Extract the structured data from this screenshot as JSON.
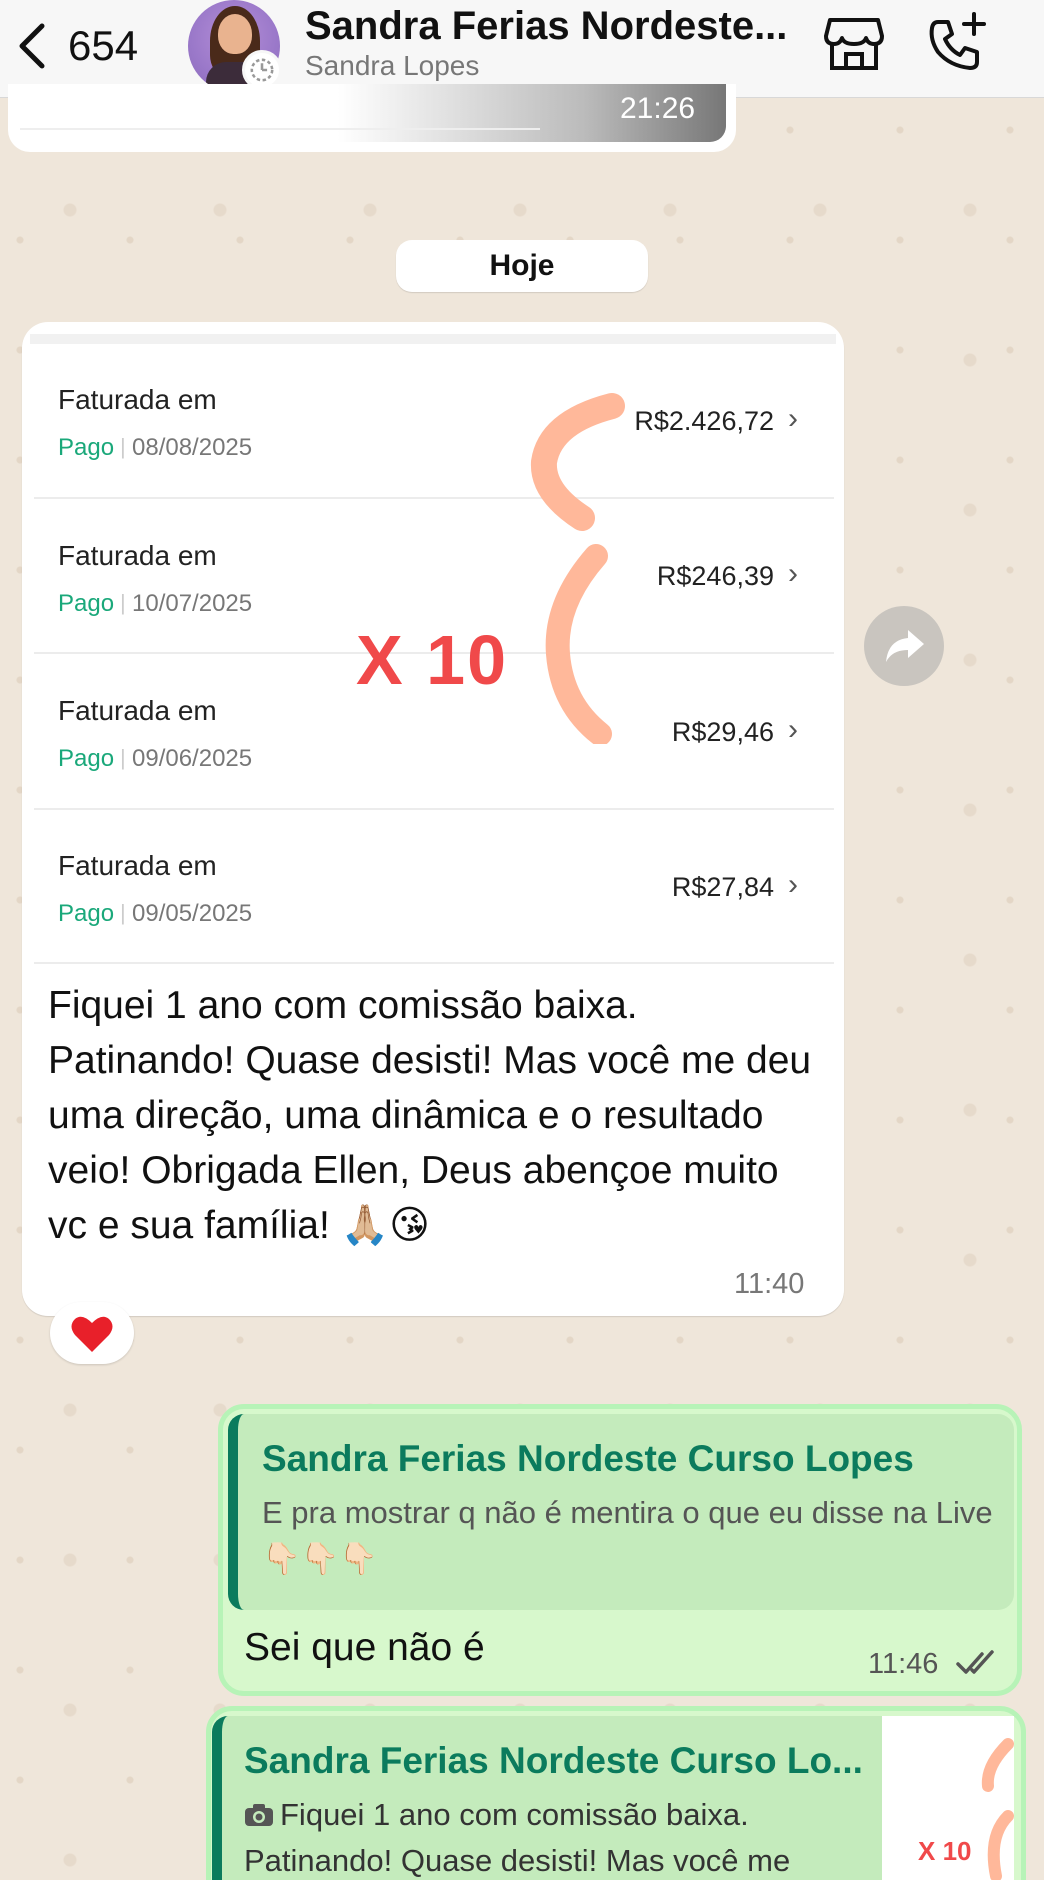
{
  "header": {
    "back_count": "654",
    "chat_name": "Sandra Ferias Nordeste...",
    "chat_subtitle": "Sandra Lopes"
  },
  "previous_message": {
    "time": "21:26"
  },
  "date_separator": "Hoje",
  "incoming_message": {
    "invoices": [
      {
        "label": "Faturada em",
        "status": "Pago",
        "date": "08/08/2025",
        "amount": "R$2.426,72"
      },
      {
        "label": "Faturada em",
        "status": "Pago",
        "date": "10/07/2025",
        "amount": "R$246,39"
      },
      {
        "label": "Faturada em",
        "status": "Pago",
        "date": "09/06/2025",
        "amount": "R$29,46"
      },
      {
        "label": "Faturada em",
        "status": "Pago",
        "date": "09/05/2025",
        "amount": "R$27,84"
      }
    ],
    "overlay_text": "X 10",
    "text": "Fiquei 1 ano com comissão baixa. Patinando! Quase desisti! Mas você me deu uma direção, uma dinâmica e o resultado veio! Obrigada Ellen, Deus abençoe muito vc e sua família! 🙏🏼😘",
    "time": "11:40",
    "reaction": "❤️"
  },
  "outgoing_message_1": {
    "quote_author": "Sandra Ferias Nordeste Curso Lopes",
    "quote_text": "E pra mostrar q não é mentira o que eu disse na Live 👇🏻👇🏻👇🏻",
    "text": "Sei que não é",
    "time": "11:46"
  },
  "outgoing_message_2": {
    "quote_author": "Sandra Ferias Nordeste Curso Lo...",
    "quote_text": "Fiquei 1 ano com comissão baixa. Patinando! Quase desisti! Mas você me",
    "thumb_text": "X 10"
  },
  "colors": {
    "accent_green": "#0b7b5d",
    "paid_green": "#1aa87a",
    "outgoing_bubble": "#d7f8cc",
    "overlay_red": "#f0494a"
  }
}
